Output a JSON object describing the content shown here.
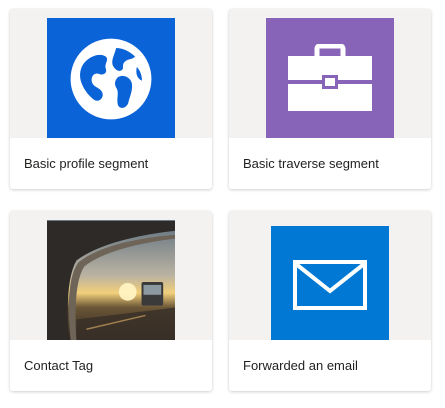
{
  "cards": [
    {
      "label": "Basic profile segment",
      "icon": "globe-icon",
      "color": "#0b63d8"
    },
    {
      "label": "Basic traverse segment",
      "icon": "briefcase-icon",
      "color": "#8764b8"
    },
    {
      "label": "Contact Tag",
      "icon": "car-mirror-photo"
    },
    {
      "label": "Forwarded an email",
      "icon": "envelope-icon",
      "color": "#0078d4"
    }
  ],
  "colors": {
    "card_bg": "#f3f2f1",
    "caption_bg": "#ffffff",
    "text": "#201f1e"
  }
}
